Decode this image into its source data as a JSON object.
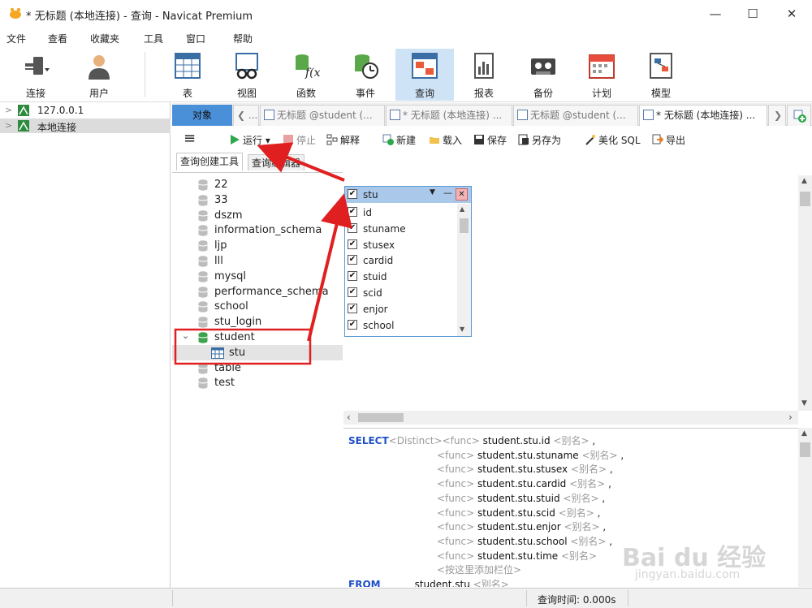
{
  "window": {
    "title": "* 无标题 (本地连接) - 查询 - Navicat Premium",
    "controls": [
      "—",
      "☐",
      "✕"
    ]
  },
  "menu": [
    "文件",
    "查看",
    "收藏夹",
    "工具",
    "窗口",
    "帮助"
  ],
  "toolbar": {
    "buttons": [
      {
        "label": "连接",
        "icon": "plug-icon"
      },
      {
        "label": "用户",
        "icon": "user-icon"
      },
      {
        "label": "表",
        "icon": "table-icon"
      },
      {
        "label": "视图",
        "icon": "view-glasses-icon"
      },
      {
        "label": "函数",
        "icon": "function-icon"
      },
      {
        "label": "事件",
        "icon": "event-clock-icon"
      },
      {
        "label": "查询",
        "icon": "query-icon",
        "active": true
      },
      {
        "label": "报表",
        "icon": "report-icon"
      },
      {
        "label": "备份",
        "icon": "backup-tape-icon"
      },
      {
        "label": "计划",
        "icon": "calendar-icon"
      },
      {
        "label": "模型",
        "icon": "model-icon"
      }
    ]
  },
  "connections": [
    {
      "label": "127.0.0.1",
      "selected": false
    },
    {
      "label": "本地连接",
      "selected": true
    }
  ],
  "tabs": {
    "object_tab": "对象",
    "items": [
      "无标题 @student (...",
      "* 无标题 (本地连接) ...",
      "无标题 @student (...",
      "* 无标题 (本地连接) ..."
    ],
    "nav_left": "❮",
    "nav_right": "❯",
    "prev_more": "..."
  },
  "query_toolbar": {
    "menu_icon": "≡",
    "run": "运行",
    "stop": "停止",
    "explain": "解释",
    "new": "新建",
    "load": "载入",
    "save": "保存",
    "save_as": "另存为",
    "beautify": "美化 SQL",
    "export": "导出"
  },
  "subtabs": {
    "builder": "查询创建工具",
    "editor": "查询编辑器"
  },
  "databases": [
    {
      "name": "22"
    },
    {
      "name": "33"
    },
    {
      "name": "dszm"
    },
    {
      "name": "information_schema"
    },
    {
      "name": "ljp"
    },
    {
      "name": "lll"
    },
    {
      "name": "mysql"
    },
    {
      "name": "performance_schema"
    },
    {
      "name": "school"
    },
    {
      "name": "stu_login"
    },
    {
      "name": "student",
      "expanded": true
    },
    {
      "name": "stu",
      "is_table": true
    },
    {
      "name": "table"
    },
    {
      "name": "test"
    }
  ],
  "table_box": {
    "title": "stu",
    "fields": [
      "id",
      "stuname",
      "stusex",
      "cardid",
      "stuid",
      "scid",
      "enjor",
      "school"
    ],
    "check": "✔",
    "min": "—",
    "close": "✕",
    "menu": "▼"
  },
  "sql": {
    "select_kw": "SELECT",
    "distinct": "<Distinct>",
    "func": "<func>",
    "alias": "<别名>",
    "add_column": "<按这里添加栏位>",
    "from_kw": "FROM",
    "from_table": "student.stu",
    "columns": [
      "student.stu.id",
      "student.stu.stuname",
      "student.stu.stusex",
      "student.stu.cardid",
      "student.stu.stuid",
      "student.stu.scid",
      "student.stu.enjor",
      "student.stu.school",
      "student.stu.time"
    ]
  },
  "status": {
    "query_time": "查询时间: 0.000s"
  },
  "watermark": {
    "brand": "Bai du 经验",
    "url": "jingyan.baidu.com"
  },
  "colors": {
    "accent": "#4a90d9",
    "keyword": "#1f4fc9",
    "annotation": "#e02020",
    "run_green": "#2da84a"
  }
}
